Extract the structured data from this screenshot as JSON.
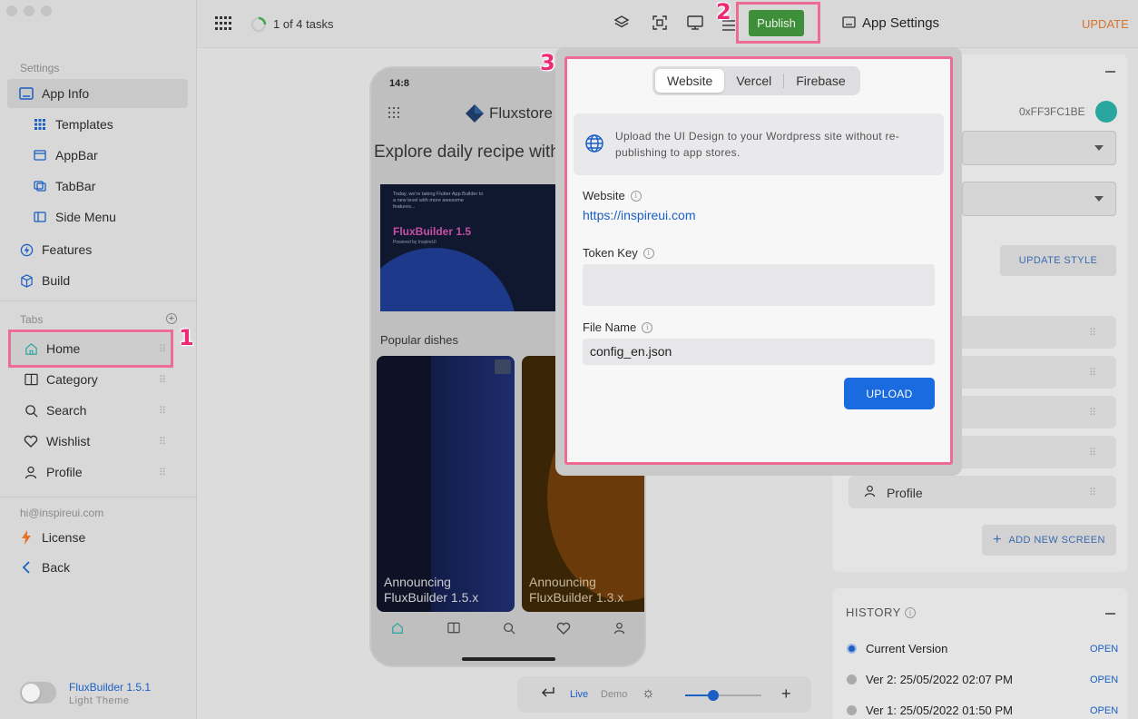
{
  "sidebar": {
    "settings_heading": "Settings",
    "app_info": "App Info",
    "sub_items": [
      "Templates",
      "AppBar",
      "TabBar",
      "Side Menu"
    ],
    "features": "Features",
    "build": "Build",
    "tabs_heading": "Tabs",
    "tabs": [
      "Home",
      "Category",
      "Search",
      "Wishlist",
      "Profile"
    ],
    "email": "hi@inspireui.com",
    "license": "License",
    "back": "Back",
    "version_title": "FluxBuilder 1.5.1",
    "theme_label": "Light Theme"
  },
  "topbar": {
    "tasks": "1 of 4 tasks",
    "publish": "Publish",
    "app_settings": "App Settings",
    "update": "UPDATE"
  },
  "phone": {
    "time": "14:8",
    "brand": "Fluxstore",
    "headline": "Explore daily recipe with",
    "banner_text": "Today, we're taking Flutter App Builder to a new level with more awesome features...",
    "banner_title": "FluxBuilder 1.5",
    "banner_sub": "Powered by InspireUI",
    "popular": "Popular dishes",
    "card1_line1": "Announcing",
    "card1_line2": "FluxBuilder 1.5.x",
    "card2_line1": "Announcing",
    "card2_line2": "FluxBuilder 1.3.x"
  },
  "bottom_toolbar": {
    "live": "Live",
    "demo": "Demo"
  },
  "right_panel": {
    "color_hex": "0xFF3FC1BE",
    "accent_color": "#3fc1be",
    "update_style": "UPDATE STYLE",
    "profile": "Profile",
    "add_new_screen": "ADD NEW SCREEN",
    "history_title": "HISTORY",
    "history": [
      {
        "label": "Current Version",
        "action": "OPEN"
      },
      {
        "label": "Ver 2: 25/05/2022 02:07 PM",
        "action": "OPEN"
      },
      {
        "label": "Ver 1: 25/05/2022 01:50 PM",
        "action": "OPEN"
      }
    ]
  },
  "modal": {
    "tabs": [
      "Website",
      "Vercel",
      "Firebase"
    ],
    "active_tab": "Website",
    "notice": "Upload the UI Design to your Wordpress site without re-publishing to app stores.",
    "website_label": "Website",
    "website_value": "https://inspireui.com",
    "token_label": "Token Key",
    "token_value": "",
    "file_label": "File Name",
    "file_value": "config_en.json",
    "upload": "UPLOAD"
  },
  "steps": [
    "1",
    "2",
    "3"
  ],
  "colors": {
    "publish_green": "#3f8f3a",
    "link_blue": "#1a5fc4",
    "upload_blue": "#1a6ae0",
    "highlight_pink": "#ee6b93"
  }
}
